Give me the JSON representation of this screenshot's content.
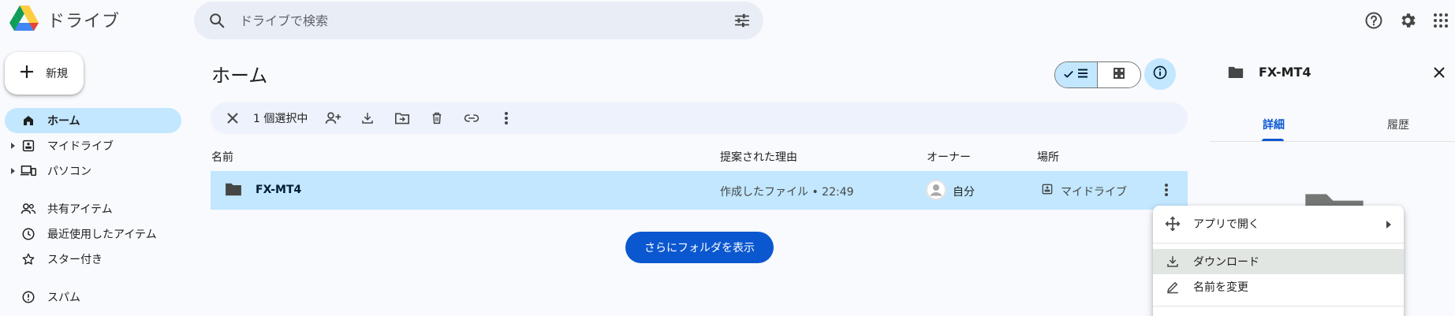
{
  "app": {
    "name": "ドライブ"
  },
  "search": {
    "placeholder": "ドライブで検索"
  },
  "sidebar": {
    "new_label": "新規",
    "items": [
      {
        "label": "ホーム",
        "icon": "home-icon"
      },
      {
        "label": "マイドライブ",
        "icon": "drive-icon"
      },
      {
        "label": "パソコン",
        "icon": "computers-icon"
      },
      {
        "label": "共有アイテム",
        "icon": "people-icon"
      },
      {
        "label": "最近使用したアイテム",
        "icon": "clock-icon"
      },
      {
        "label": "スター付き",
        "icon": "star-icon"
      },
      {
        "label": "スパム",
        "icon": "spam-icon"
      }
    ]
  },
  "main": {
    "title": "ホーム",
    "selection": {
      "count_label": "1 個選択中"
    },
    "columns": {
      "name": "名前",
      "reason": "提案された理由",
      "owner": "オーナー",
      "location": "場所"
    },
    "rows": [
      {
        "name": "FX-MT4",
        "reason": "作成したファイル • 22:49",
        "owner": "自分",
        "location": "マイドライブ"
      }
    ],
    "more_folders_label": "さらにフォルダを表示"
  },
  "details": {
    "title": "FX-MT4",
    "tabs": [
      "詳細",
      "履歴"
    ]
  },
  "context_menu": {
    "items": [
      "アプリで開く",
      "ダウンロード",
      "名前を変更"
    ]
  },
  "colors": {
    "accent": "#0b57d0",
    "selected": "#c2e7ff",
    "bar": "#edf2fc"
  }
}
